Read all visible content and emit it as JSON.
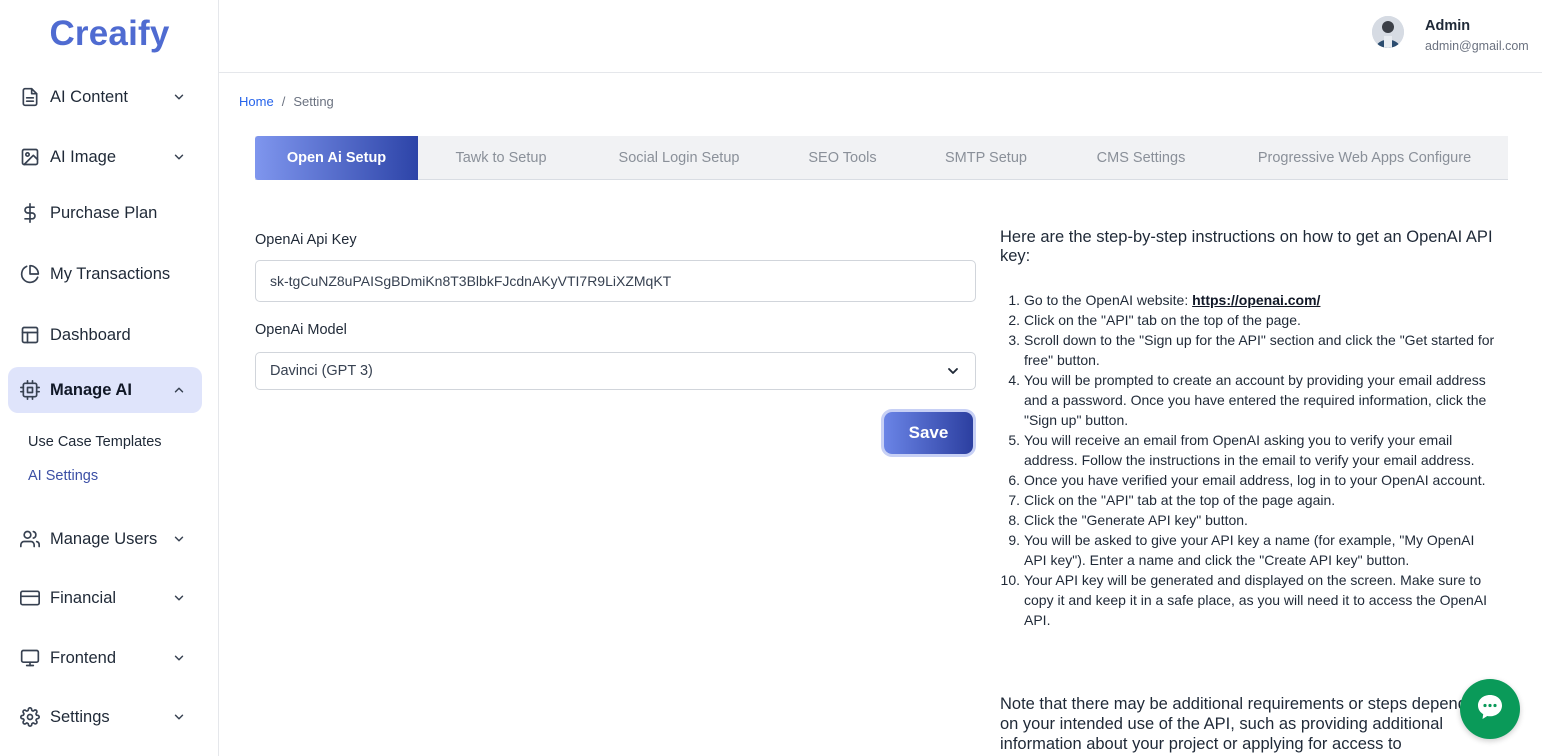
{
  "app": {
    "logo": "Creaify"
  },
  "sidebar": {
    "items": [
      {
        "label": "AI Content",
        "icon": "document-icon"
      },
      {
        "label": "AI Image",
        "icon": "image-icon"
      },
      {
        "label": "Purchase Plan",
        "icon": "dollar-icon"
      },
      {
        "label": "My Transactions",
        "icon": "pie-chart-icon"
      },
      {
        "label": "Dashboard",
        "icon": "layout-icon"
      },
      {
        "label": "Manage AI",
        "icon": "cpu-icon",
        "active": true
      },
      {
        "label": "Manage Users",
        "icon": "users-icon"
      },
      {
        "label": "Financial",
        "icon": "credit-card-icon"
      },
      {
        "label": "Frontend",
        "icon": "monitor-icon"
      },
      {
        "label": "Settings",
        "icon": "gear-icon"
      }
    ],
    "sub_items": [
      {
        "label": "Use Case Templates"
      },
      {
        "label": "AI Settings",
        "active": true
      }
    ]
  },
  "header": {
    "user_name": "Admin",
    "user_email": "admin@gmail.com"
  },
  "breadcrumb": {
    "home": "Home",
    "separator": "/",
    "current": "Setting"
  },
  "tabs": [
    {
      "label": "Open Ai Setup",
      "active": true
    },
    {
      "label": "Tawk to Setup"
    },
    {
      "label": "Social Login Setup"
    },
    {
      "label": "SEO Tools"
    },
    {
      "label": "SMTP Setup"
    },
    {
      "label": "CMS Settings"
    },
    {
      "label": "Progressive Web Apps Configure"
    }
  ],
  "form": {
    "api_key_label": "OpenAi Api Key",
    "api_key_value": "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",
    "model_label": "OpenAi Model",
    "model_value": "Davinci (GPT 3)",
    "save_label": "Save"
  },
  "instructions": {
    "title": "Here are the step-by-step instructions on how to get an OpenAI API key:",
    "step1_prefix": "Go to the OpenAI website: ",
    "step1_link": "https://openai.com/",
    "steps": [
      {
        "num": "2.",
        "text": "Click on the \"API\" tab on the top of the page."
      },
      {
        "num": "3.",
        "text": "Scroll down to the \"Sign up for the API\" section and click the \"Get started for free\" button."
      },
      {
        "num": "4.",
        "text": "You will be prompted to create an account by providing your email address and a password. Once you have entered the required information, click the \"Sign up\" button."
      },
      {
        "num": "5.",
        "text": "You will receive an email from OpenAI asking you to verify your email address. Follow the instructions in the email to verify your email address."
      },
      {
        "num": "6.",
        "text": "Once you have verified your email address, log in to your OpenAI account."
      },
      {
        "num": "7.",
        "text": "Click on the \"API\" tab at the top of the page again."
      },
      {
        "num": "8.",
        "text": "Click the \"Generate API key\" button."
      },
      {
        "num": "9.",
        "text": "You will be asked to give your API key a name (for example, \"My OpenAI API key\"). Enter a name and click the \"Create API key\" button."
      },
      {
        "num": "10.",
        "text": "Your API key will be generated and displayed on the screen. Make sure to copy it and keep it in a safe place, as you will need it to access the OpenAI API."
      }
    ],
    "note": "Note that there may be additional requirements or steps depending on your intended use of the API, such as providing additional information about your project or applying for access to"
  },
  "colors": {
    "brand": "#4f6bd1",
    "accent_start": "#7f96ee",
    "accent_end": "#2d44a8",
    "chat": "#0a9a59"
  }
}
